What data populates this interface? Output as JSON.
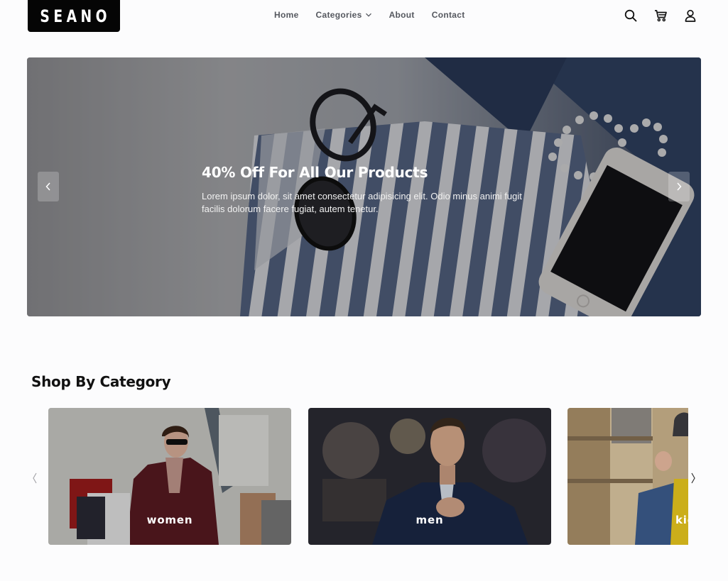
{
  "brand": {
    "logo_text": "SEANO"
  },
  "nav": {
    "home": "Home",
    "categories": "Categories",
    "about": "About",
    "contact": "Contact"
  },
  "header_icons": [
    "search-icon",
    "cart-icon",
    "user-icon"
  ],
  "hero": {
    "title": "40% Off For All Our Products",
    "description": "Lorem ipsum dolor, sit amet consectetur adipisicing elit. Odio minus animi fugit facilis dolorum facere fugiat, autem tenetur."
  },
  "categories_section": {
    "title": "Shop By Category",
    "items": [
      {
        "label": "women"
      },
      {
        "label": "men"
      },
      {
        "label": "kids"
      }
    ]
  },
  "colors": {
    "logo_bg": "#050505",
    "nav_text": "#55585f",
    "page_bg": "#fcfcfd"
  }
}
